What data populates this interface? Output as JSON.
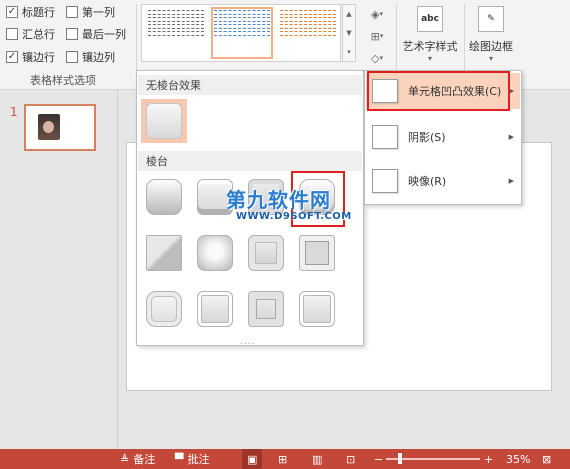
{
  "ribbon": {
    "options": [
      {
        "label": "标题行",
        "checked": true
      },
      {
        "label": "汇总行",
        "checked": false
      },
      {
        "label": "镶边行",
        "checked": true
      },
      {
        "label": "第一列",
        "checked": false
      },
      {
        "label": "最后一列",
        "checked": false
      },
      {
        "label": "镶边列",
        "checked": false
      }
    ],
    "options_group_label": "表格样式选项",
    "checkmark": "✓",
    "wordart_label": "艺术字样式",
    "wordart_icon_text": "abc",
    "border_label": "绘图边框"
  },
  "gallery": {
    "styles": [
      {
        "color": "#6e6e6e"
      },
      {
        "color": "#4a86c8"
      },
      {
        "color": "#e07d2e"
      }
    ]
  },
  "slides": {
    "current_number": "1"
  },
  "bevel_panel": {
    "no_bevel_title": "无棱台效果",
    "bevel_title": "棱台",
    "more_indicator": "...."
  },
  "submenu": {
    "items": [
      {
        "label": "单元格凹凸效果(C)",
        "highlighted": true
      },
      {
        "label": "阴影(S)",
        "highlighted": false
      },
      {
        "label": "映像(R)",
        "highlighted": false
      }
    ]
  },
  "statusbar": {
    "notes_label": "备注",
    "comments_label": "批注",
    "zoom_percent": "35%",
    "zoom_value": 0.35,
    "accent": "#c4483a"
  },
  "watermark": {
    "text": "第九软件网",
    "url": "WWW.D9SOFT.COM"
  }
}
